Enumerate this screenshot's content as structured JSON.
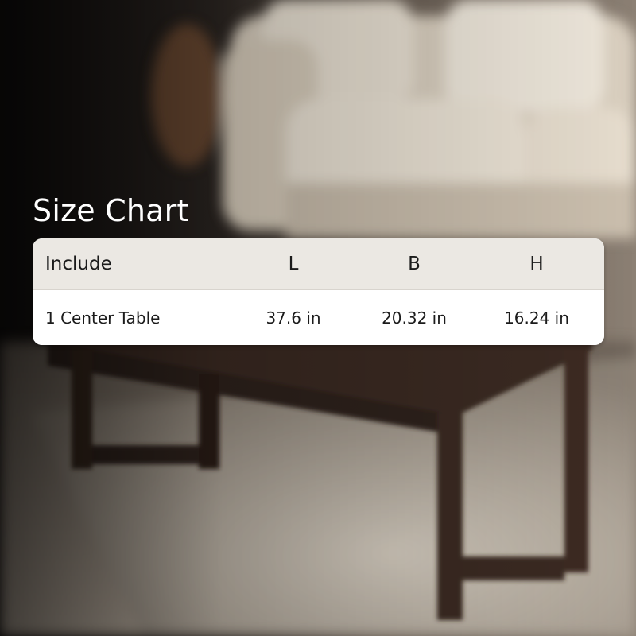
{
  "size_chart": {
    "title": "Size Chart",
    "columns": [
      "Include",
      "L",
      "B",
      "H"
    ],
    "rows": [
      [
        "1 Center Table",
        "37.6 in",
        "20.32 in",
        "16.24 in"
      ]
    ]
  },
  "background": {
    "description_icon": "living-room-photo",
    "colors": {
      "wall_dark": "#1e1a17",
      "sofa": "#e7ddcb",
      "table_wood": "#3b2a22",
      "rug": "#cfc6b8"
    }
  }
}
